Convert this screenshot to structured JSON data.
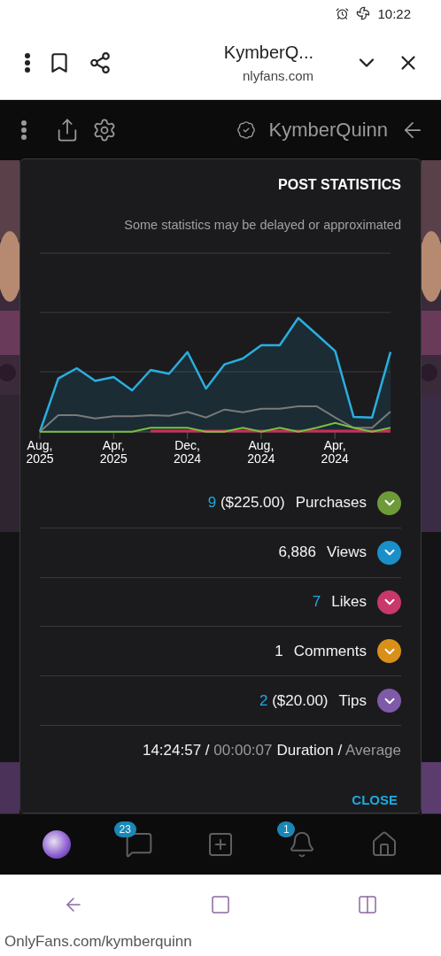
{
  "status_bar": {
    "time": "10:22"
  },
  "browser": {
    "title": "KymberQ...",
    "domain": "nlyfans.com"
  },
  "header": {
    "name": "KymberQuinn",
    "verified": true
  },
  "modal": {
    "title": "POST STATISTICS",
    "note": "Some statistics may be delayed or approximated",
    "x_labels": [
      {
        "month": "Aug,",
        "year": "2025"
      },
      {
        "month": "Apr,",
        "year": "2025"
      },
      {
        "month": "Dec,",
        "year": "2024"
      },
      {
        "month": "Aug,",
        "year": "2024"
      },
      {
        "month": "Apr,",
        "year": "2024"
      }
    ],
    "stats": [
      {
        "label": "Purchases",
        "color": "#6e9a3a",
        "count": "9",
        "amount": "($225.00)",
        "highlighted": true
      },
      {
        "label": "Views",
        "color": "#1a8fc9",
        "count": "6,886",
        "highlighted": false
      },
      {
        "label": "Likes",
        "color": "#c8386a",
        "count": "7",
        "highlighted": true
      },
      {
        "label": "Comments",
        "color": "#d8901a",
        "count": "1",
        "highlighted": false
      },
      {
        "label": "Tips",
        "color": "#7e5aa8",
        "count": "2",
        "amount": "($20.00)",
        "highlighted": true
      }
    ],
    "duration": {
      "label": "Duration /",
      "sub_label": "Average",
      "value": "14:24:57 /",
      "sub_value": "00:00:07"
    },
    "close_label": "CLOSE"
  },
  "bottom_nav": [
    {
      "kind": "avatar"
    },
    {
      "kind": "messages",
      "badge": "23"
    },
    {
      "kind": "plus"
    },
    {
      "kind": "bell",
      "badge": "1"
    },
    {
      "kind": "home"
    }
  ],
  "address_bar": {
    "url": "OnlyFans.com/kymberquinn"
  }
}
